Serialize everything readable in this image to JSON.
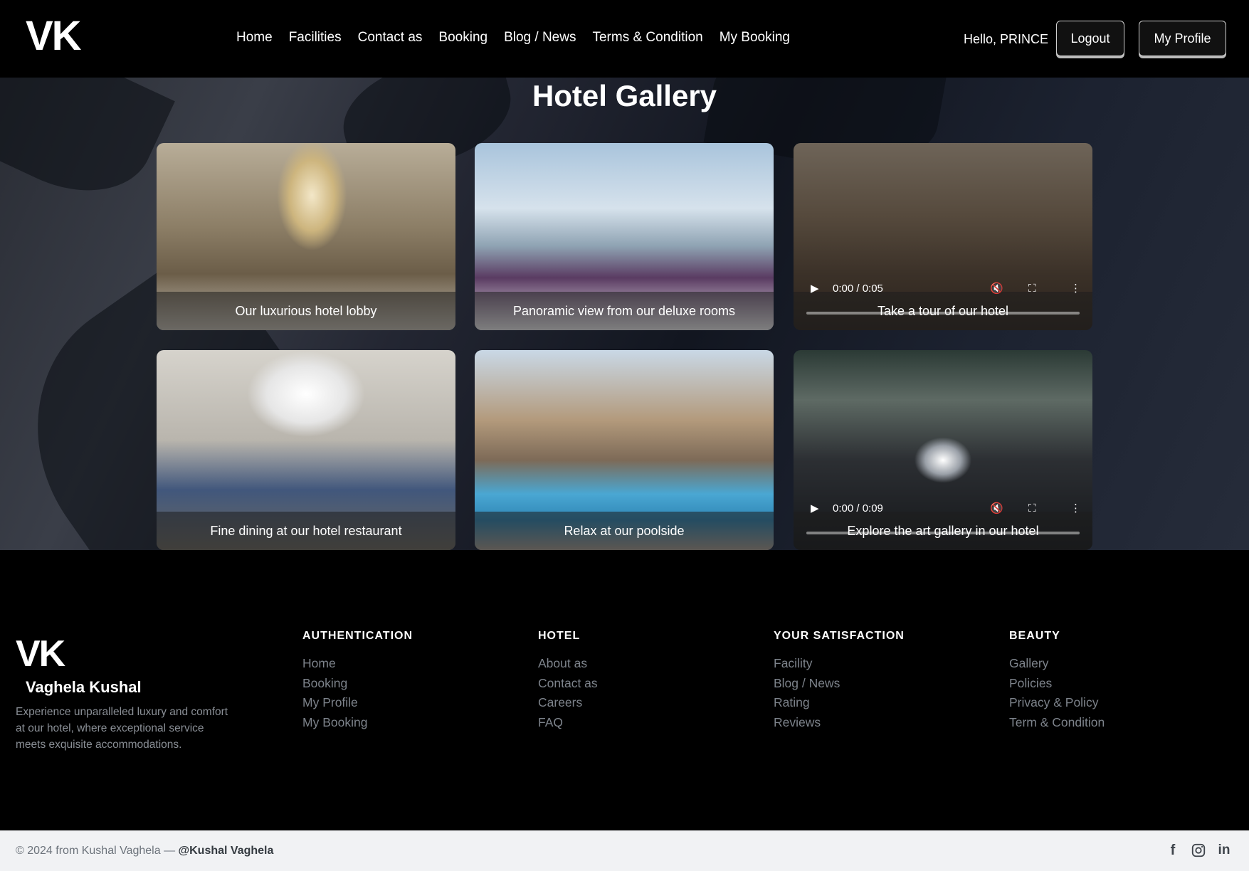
{
  "navbar": {
    "logo": "VK",
    "links": [
      "Home",
      "Facilities",
      "Contact as",
      "Booking",
      "Blog / News",
      "Terms & Condition",
      "My Booking"
    ],
    "greeting": "Hello, PRINCE",
    "logout_label": "Logout",
    "profile_label": "My Profile"
  },
  "gallery": {
    "title": "Hotel Gallery",
    "items": [
      {
        "type": "image",
        "caption": "Our luxurious hotel lobby"
      },
      {
        "type": "image",
        "caption": "Panoramic view from our deluxe rooms"
      },
      {
        "type": "video",
        "caption": "Take a tour of our hotel",
        "time": "0:00 / 0:05"
      },
      {
        "type": "image",
        "caption": "Fine dining at our hotel restaurant"
      },
      {
        "type": "image",
        "caption": "Relax at our poolside"
      },
      {
        "type": "video",
        "caption": "Explore the art gallery in our hotel",
        "time": "0:00 / 0:09"
      }
    ]
  },
  "footer": {
    "logo": "VK",
    "name": "Vaghela Kushal",
    "description": "Experience unparalleled luxury and comfort at our hotel, where exceptional service meets exquisite accommodations.",
    "columns": [
      {
        "heading": "AUTHENTICATION",
        "links": [
          "Home",
          "Booking",
          "My Profile",
          "My Booking"
        ]
      },
      {
        "heading": "HOTEL",
        "links": [
          "About as",
          "Contact as",
          "Careers",
          "FAQ"
        ]
      },
      {
        "heading": "YOUR SATISFACTION",
        "links": [
          "Facility",
          "Blog / News",
          "Rating",
          "Reviews"
        ]
      },
      {
        "heading": "BEAUTY",
        "links": [
          "Gallery",
          "Policies",
          "Privacy & Policy",
          "Term & Condition"
        ]
      }
    ],
    "copyright": "© 2024 from Kushal Vaghela — ",
    "copyright_handle": "@Kushal Vaghela",
    "social": [
      "facebook-icon",
      "instagram-icon",
      "linkedin-icon"
    ]
  }
}
